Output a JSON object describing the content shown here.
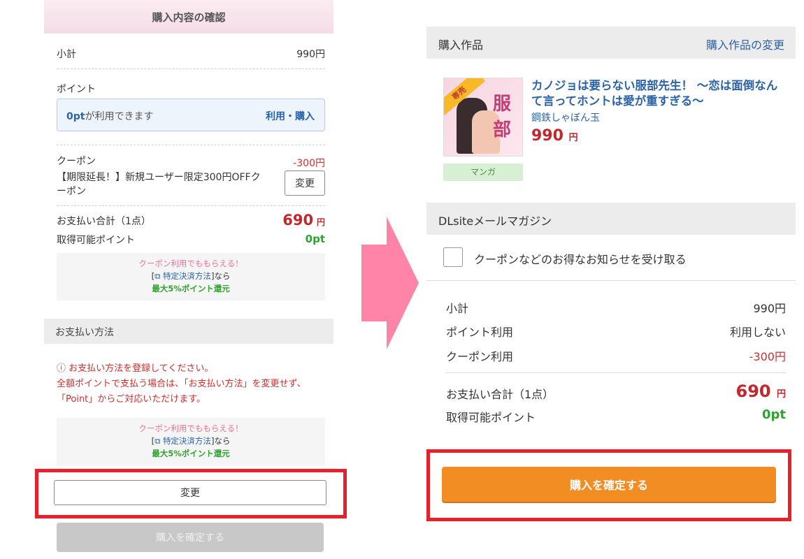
{
  "left": {
    "header": "購入内容の確認",
    "subtotal_label": "小計",
    "subtotal_value": "990円",
    "points_label": "ポイント",
    "points_box_highlight": "0pt",
    "points_box_text": "が利用できます",
    "points_box_action": "利用・購入",
    "coupon_label": "クーポン",
    "coupon_value": "-300円",
    "coupon_desc": "【期限延長！】新規ユーザー限定300円OFFクーポン",
    "coupon_change": "変更",
    "total_label": "お支払い合計（1点）",
    "total_value": "690",
    "total_unit": "円",
    "earn_label": "取得可能ポイント",
    "earn_value": "0pt",
    "promo_line1": "クーポン利用でももらえる！",
    "promo_link": "特定決済方法",
    "promo_open": "[",
    "promo_close": "]なら",
    "promo_line3": "最大5%ポイント還元",
    "payment_header": "お支払い方法",
    "warn_line1": "お支払い方法を登録してください。",
    "warn_line2": "全額ポイントで支払う場合は、「お支払い方法」を変更せず、「Point」からご対応いただけます。",
    "change_button": "変更",
    "confirm_button": "購入を確定する"
  },
  "right": {
    "purchase_header": "購入作品",
    "purchase_change": "購入作品の変更",
    "badge": "専売",
    "cover_text": "服部",
    "category": "マンガ",
    "title": "カノジョは要らない服部先生！ 〜恋は面倒なんて言ってホントは愛が重すぎる〜",
    "author": "鋼鉄しゃぼん玉",
    "price": "990",
    "price_unit": "円",
    "mail_header": "DLsiteメールマガジン",
    "mail_checkbox_label": "クーポンなどのお得なお知らせを受け取る",
    "subtotal_label": "小計",
    "subtotal_value": "990円",
    "point_use_label": "ポイント利用",
    "point_use_value": "利用しない",
    "coupon_use_label": "クーポン利用",
    "coupon_use_value": "-300円",
    "total_label": "お支払い合計（1点）",
    "total_value": "690",
    "total_unit": "円",
    "earn_label": "取得可能ポイント",
    "earn_value": "0pt",
    "confirm_button": "購入を確定する"
  },
  "colors": {
    "accent_red": "#c2272d",
    "point_green": "#2fa32f",
    "link_blue": "#2a63a8",
    "confirm_orange": "#f28d24",
    "highlight_box": "#e8202a",
    "arrow_pink": "#ff84a8"
  }
}
